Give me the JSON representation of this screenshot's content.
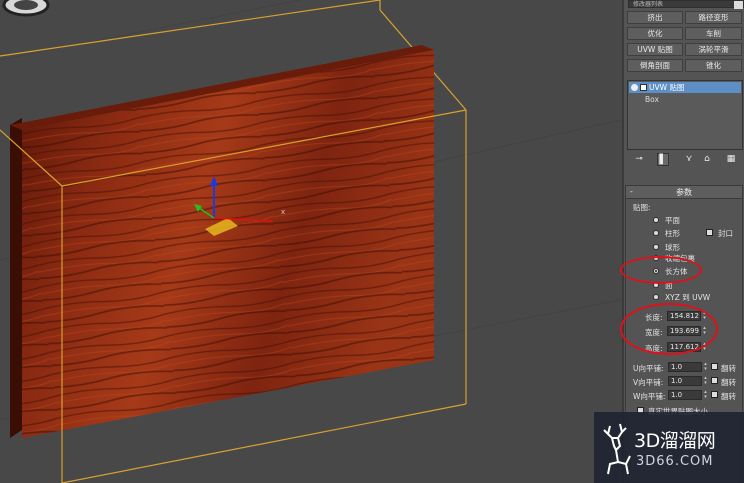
{
  "modifier_list": {
    "label": "修改器列表"
  },
  "modifier_buttons": [
    "挤出",
    "路径变形",
    "优化",
    "车削",
    "UVW 贴图",
    "涡轮平滑",
    "倒角剖面",
    "锥化"
  ],
  "stack": {
    "items": [
      "UVW 贴图",
      "Box"
    ],
    "selected": "UVW 贴图"
  },
  "stack_tools": {
    "pin": "pin-stack-icon",
    "show_end": "show-end-result-icon",
    "unique": "make-unique-icon",
    "remove": "remove-modifier-icon",
    "configure": "configure-sets-icon"
  },
  "params": {
    "title": "参数",
    "mapping_label": "贴图:",
    "mapping_types": [
      "平面",
      "柱形",
      "球形",
      "收缩包裹",
      "长方体",
      "面",
      "XYZ 到 UVW"
    ],
    "selected_mapping": "长方体",
    "cap_label": "封口",
    "length_label": "长度:",
    "length": "154.812",
    "width_label": "宽度:",
    "width": "193.699",
    "height_label": "高度:",
    "height": "117.612",
    "u_tile_label": "U向平铺:",
    "u_tile": "1.0",
    "v_tile_label": "V向平铺:",
    "v_tile": "1.0",
    "w_tile_label": "W向平铺:",
    "w_tile": "1.0",
    "flip_label": "翻转",
    "real_world_label": "真实世界贴图大小"
  },
  "viewport": {
    "gizmo_axis_x": "x",
    "wood_color": "#8a2a12",
    "bbox_color": "#d9a030",
    "view_cube": "view-cube-icon"
  },
  "watermark": {
    "title": "3D溜溜网",
    "subtitle": "3D66.COM"
  },
  "annotation_color": "#e0101a"
}
